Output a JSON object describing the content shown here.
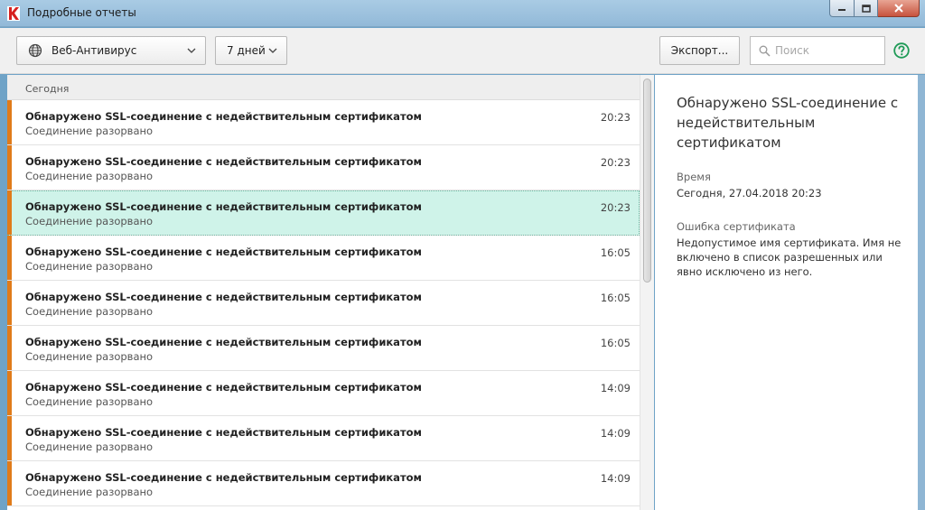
{
  "window": {
    "title": "Подробные отчеты"
  },
  "toolbar": {
    "component_select": "Веб-Антивирус",
    "period_select": "7 дней",
    "export_label": "Экспорт...",
    "search_placeholder": "Поиск"
  },
  "list": {
    "group_label": "Сегодня",
    "rows": [
      {
        "title": "Обнаружено SSL-соединение с недействительным сертификатом",
        "subtitle": "Соединение разорвано",
        "time": "20:23",
        "selected": false
      },
      {
        "title": "Обнаружено SSL-соединение с недействительным сертификатом",
        "subtitle": "Соединение разорвано",
        "time": "20:23",
        "selected": false
      },
      {
        "title": "Обнаружено SSL-соединение с недействительным сертификатом",
        "subtitle": "Соединение разорвано",
        "time": "20:23",
        "selected": true
      },
      {
        "title": "Обнаружено SSL-соединение с недействительным сертификатом",
        "subtitle": "Соединение разорвано",
        "time": "16:05",
        "selected": false
      },
      {
        "title": "Обнаружено SSL-соединение с недействительным сертификатом",
        "subtitle": "Соединение разорвано",
        "time": "16:05",
        "selected": false
      },
      {
        "title": "Обнаружено SSL-соединение с недействительным сертификатом",
        "subtitle": "Соединение разорвано",
        "time": "16:05",
        "selected": false
      },
      {
        "title": "Обнаружено SSL-соединение с недействительным сертификатом",
        "subtitle": "Соединение разорвано",
        "time": "14:09",
        "selected": false
      },
      {
        "title": "Обнаружено SSL-соединение с недействительным сертификатом",
        "subtitle": "Соединение разорвано",
        "time": "14:09",
        "selected": false
      },
      {
        "title": "Обнаружено SSL-соединение с недействительным сертификатом",
        "subtitle": "Соединение разорвано",
        "time": "14:09",
        "selected": false
      }
    ]
  },
  "detail": {
    "title": "Обнаружено SSL-соединение с недействительным сертификатом",
    "time_label": "Время",
    "time_value": "Сегодня, 27.04.2018 20:23",
    "error_label": "Ошибка сертификата",
    "error_value": "Недопустимое имя сертификата.  Имя не включено в список разрешенных или явно исключено из него."
  },
  "colors": {
    "severity_stripe": "#e07b1a",
    "selected_row": "#cff3e9",
    "help_icon": "#1e9a56"
  },
  "icons": {
    "app": "kaspersky-logo-icon",
    "component": "globe-icon",
    "dropdown": "chevron-down-icon",
    "search": "search-icon",
    "help": "help-icon"
  }
}
